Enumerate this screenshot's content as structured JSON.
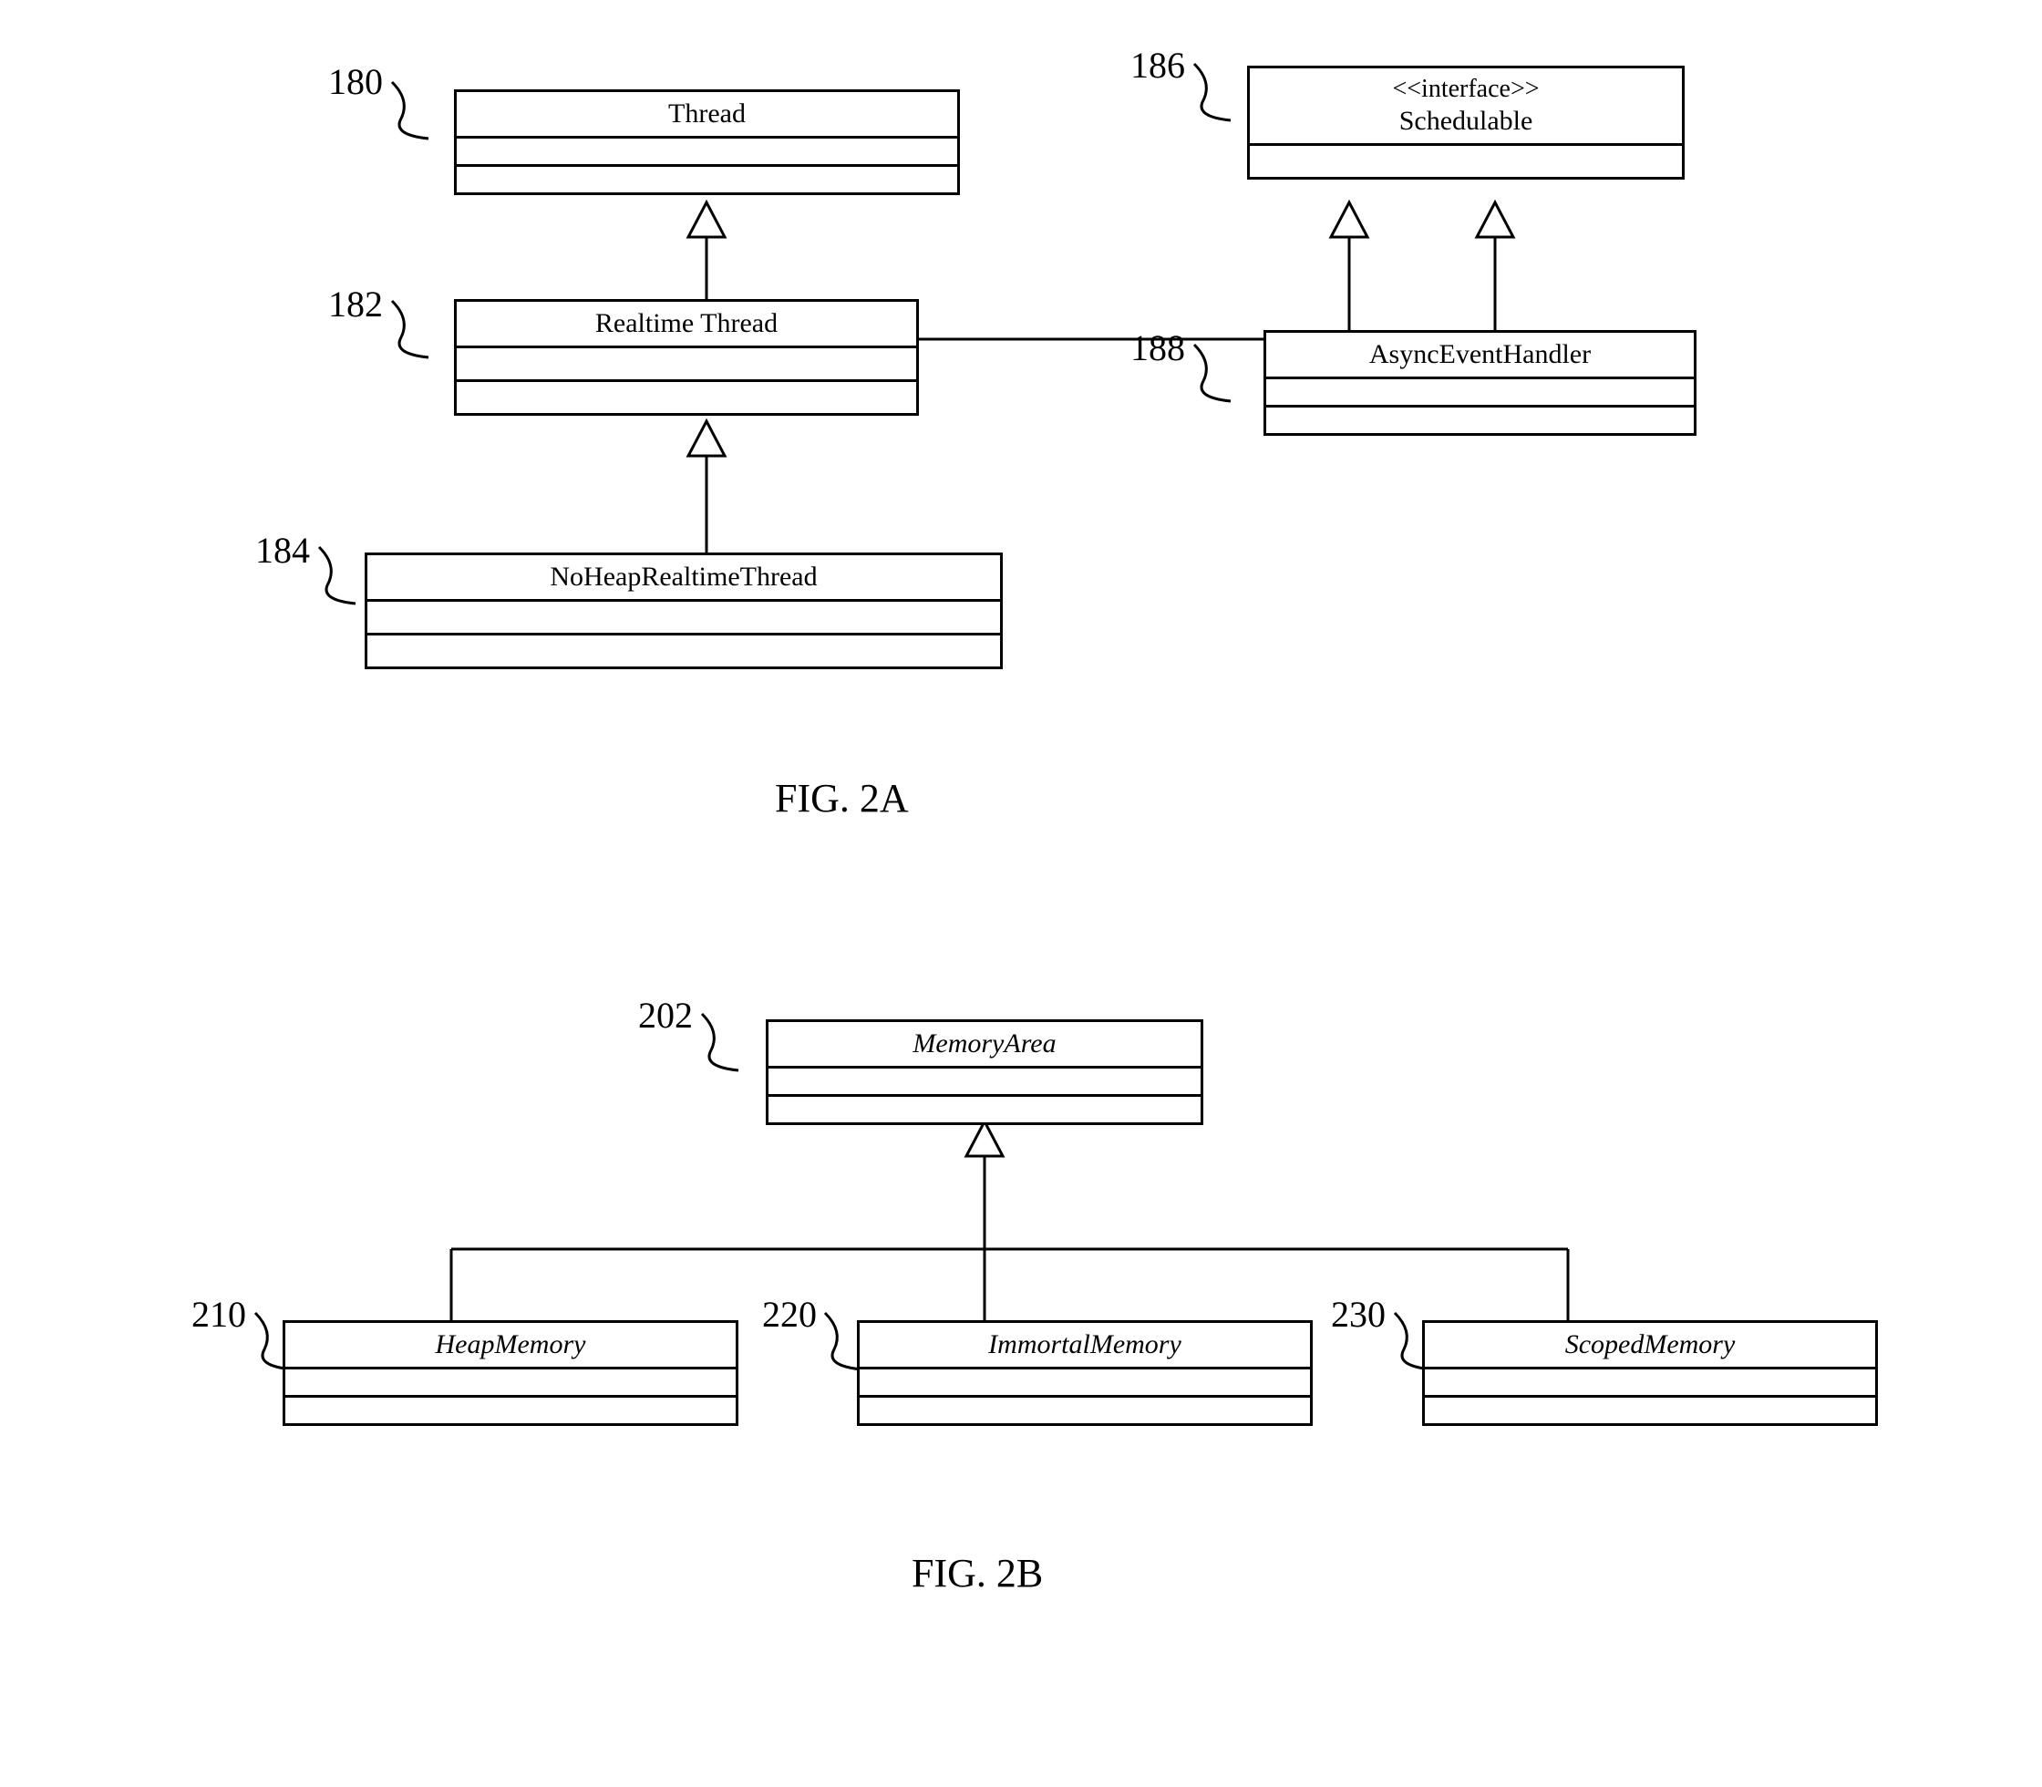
{
  "figA": {
    "caption": "FIG. 2A",
    "boxes": {
      "thread": {
        "ref": "180",
        "title": "Thread"
      },
      "realtime": {
        "ref": "182",
        "title": "Realtime Thread"
      },
      "noheap": {
        "ref": "184",
        "title": "NoHeapRealtimeThread"
      },
      "schedulable": {
        "ref": "186",
        "stereo": "<<interface>>",
        "title": "Schedulable"
      },
      "asynch": {
        "ref": "188",
        "title": "AsyncEventHandler"
      }
    }
  },
  "figB": {
    "caption": "FIG. 2B",
    "boxes": {
      "memarea": {
        "ref": "202",
        "title": "MemoryArea"
      },
      "heap": {
        "ref": "210",
        "title": "HeapMemory"
      },
      "immortal": {
        "ref": "220",
        "title": "ImmortalMemory"
      },
      "scoped": {
        "ref": "230",
        "title": "ScopedMemory"
      }
    }
  }
}
